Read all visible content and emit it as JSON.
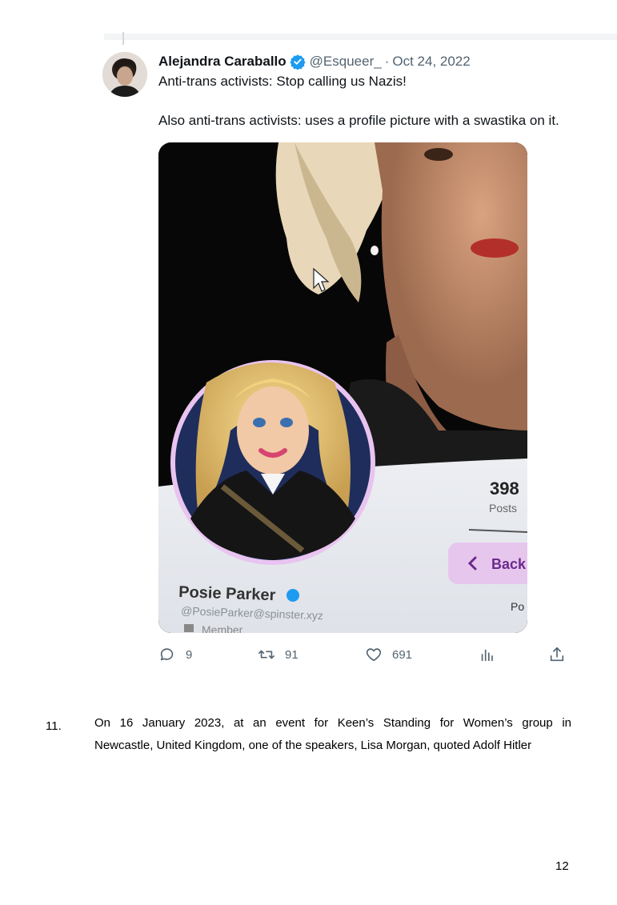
{
  "tweet": {
    "author_name": "Alejandra Caraballo",
    "handle": "@Esqueer_",
    "separator": "·",
    "date": "Oct 24, 2022",
    "text_line_1": "Anti-trans activists: Stop calling us Nazis!",
    "text_line_2": "Also anti-trans activists: uses a profile picture with a swastika on it.",
    "image": {
      "profile_posts_count": "398",
      "profile_posts_label": "Posts",
      "back_label": "Back",
      "tab_partial": "Po",
      "profile_name": "Posie Parker",
      "profile_handle": "@PosieParker@spinster.xyz",
      "profile_member_partial": "Member"
    },
    "actions": {
      "replies": "9",
      "retweets": "91",
      "likes": "691"
    },
    "colors": {
      "verified_blue": "#1d9bf0",
      "muted_text": "#536471",
      "back_button_purple": "#6b2a8c"
    }
  },
  "document": {
    "paragraph_number": "11.",
    "paragraph_line_1": "On 16 January 2023, at an event for Keen’s Standing for Women’s group in",
    "paragraph_line_2": "Newcastle, United Kingdom, one of the speakers, Lisa Morgan, quoted Adolf Hitler",
    "page_number": "12"
  }
}
